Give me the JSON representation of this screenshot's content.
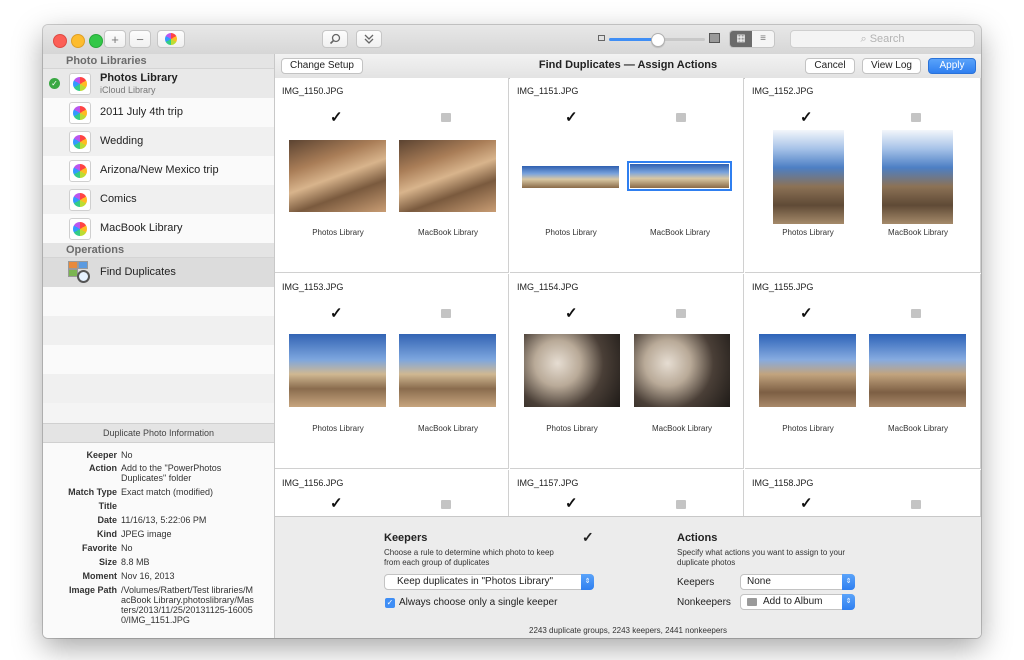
{
  "window": {
    "toolbar": {
      "add_label": "+",
      "remove_label": "−",
      "search_placeholder": "Search"
    }
  },
  "sidebar": {
    "libraries_header": "Photo Libraries",
    "libraries": [
      {
        "name": "Photos Library",
        "subtitle": "iCloud Library",
        "active": true
      },
      {
        "name": "2011 July 4th trip"
      },
      {
        "name": "Wedding"
      },
      {
        "name": "Arizona/New Mexico trip"
      },
      {
        "name": "Comics"
      },
      {
        "name": "MacBook Library"
      }
    ],
    "operations_header": "Operations",
    "operations": [
      {
        "name": "Find Duplicates"
      }
    ],
    "info": {
      "title": "Duplicate Photo Information",
      "rows": [
        {
          "key": "Keeper",
          "value": "No"
        },
        {
          "key": "Action",
          "value": "Add to the \"PowerPhotos Duplicates\" folder"
        },
        {
          "key": "Match Type",
          "value": "Exact match (modified)"
        },
        {
          "key": "Title",
          "value": ""
        },
        {
          "key": "Date",
          "value": "11/16/13, 5:22:06 PM"
        },
        {
          "key": "Kind",
          "value": "JPEG image"
        },
        {
          "key": "Favorite",
          "value": "No"
        },
        {
          "key": "Size",
          "value": "8.8 MB"
        },
        {
          "key": "Moment",
          "value": "Nov 16, 2013"
        },
        {
          "key": "Image Path",
          "value": "/Volumes/Ratbert/Test libraries/MacBook Library.photoslibrary/Masters/2013/11/25/20131125-160050/IMG_1151.JPG"
        }
      ]
    }
  },
  "main": {
    "change_setup": "Change Setup",
    "title": "Find Duplicates — Assign Actions",
    "cancel": "Cancel",
    "view_log": "View Log",
    "apply": "Apply",
    "check_mark": "✓",
    "groups": [
      {
        "name": "IMG_1150.JPG",
        "left": "Photos Library",
        "right": "MacBook Library",
        "scene": "rock"
      },
      {
        "name": "IMG_1151.JPG",
        "left": "Photos Library",
        "right": "MacBook Library",
        "scene": "pano"
      },
      {
        "name": "IMG_1152.JPG",
        "left": "Photos Library",
        "right": "MacBook Library",
        "scene": "sky"
      },
      {
        "name": "IMG_1153.JPG",
        "left": "Photos Library",
        "right": "MacBook Library",
        "scene": "valley"
      },
      {
        "name": "IMG_1154.JPG",
        "left": "Photos Library",
        "right": "MacBook Library",
        "scene": "closeup"
      },
      {
        "name": "IMG_1155.JPG",
        "left": "Photos Library",
        "right": "MacBook Library",
        "scene": "boulders"
      },
      {
        "name": "IMG_1156.JPG"
      },
      {
        "name": "IMG_1157.JPG"
      },
      {
        "name": "IMG_1158.JPG"
      }
    ]
  },
  "bottom": {
    "keepers_title": "Keepers",
    "keepers_desc": "Choose a rule to determine which photo to keep from each group of duplicates",
    "keepers_rule": "Keep duplicates in \"Photos Library\"",
    "single_keeper_label": "Always choose only a single keeper",
    "single_keeper_checked": true,
    "actions_title": "Actions",
    "actions_desc": "Specify what actions you want to assign to your duplicate photos",
    "keepers_label": "Keepers",
    "keepers_action": "None",
    "nonkeepers_label": "Nonkeepers",
    "nonkeepers_action": "Add to Album",
    "summary": "2243 duplicate groups, 2243 keepers, 2441 nonkeepers"
  },
  "colors": {
    "accent": "#2f7ff0",
    "check_green": "#3aa843"
  }
}
